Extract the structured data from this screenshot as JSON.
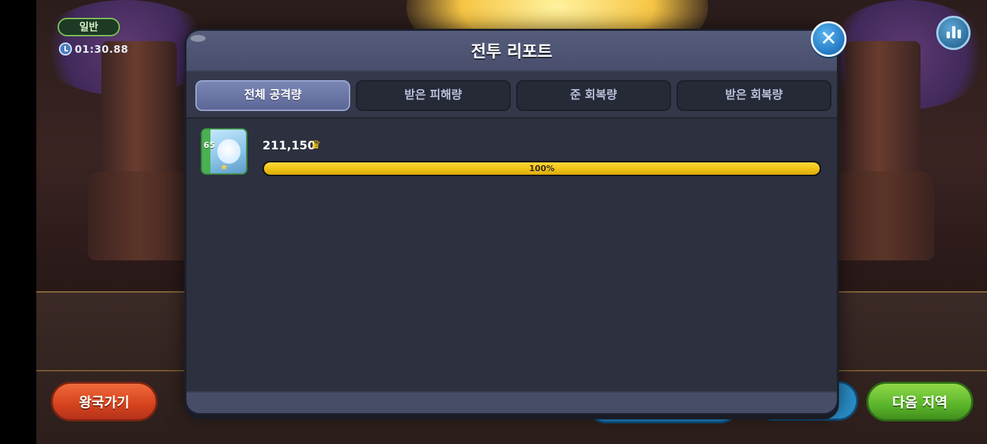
{
  "hud": {
    "mode": "일반",
    "timer": "01:30.88"
  },
  "modal": {
    "title": "전투 리포트",
    "tabs": [
      {
        "label": "전체 공격량",
        "active": true
      },
      {
        "label": "받은 피해량",
        "active": false
      },
      {
        "label": "준 회복량",
        "active": false
      },
      {
        "label": "받은 회복량",
        "active": false
      }
    ],
    "entries": [
      {
        "level": "65",
        "value": "211,150",
        "top_rank": true,
        "percent_label": "100%",
        "percent": 100
      }
    ]
  },
  "buttons": {
    "kingdom": "왕국가기",
    "next_area": "다음 지역"
  },
  "icons": {
    "close": "close-icon",
    "stats": "bar-chart-icon",
    "timer": "clock-icon",
    "rank": "crown-icon"
  },
  "colors": {
    "progress": "#f0c213",
    "active_tab": "#6c78a6",
    "close_button": "#2f86cf"
  }
}
